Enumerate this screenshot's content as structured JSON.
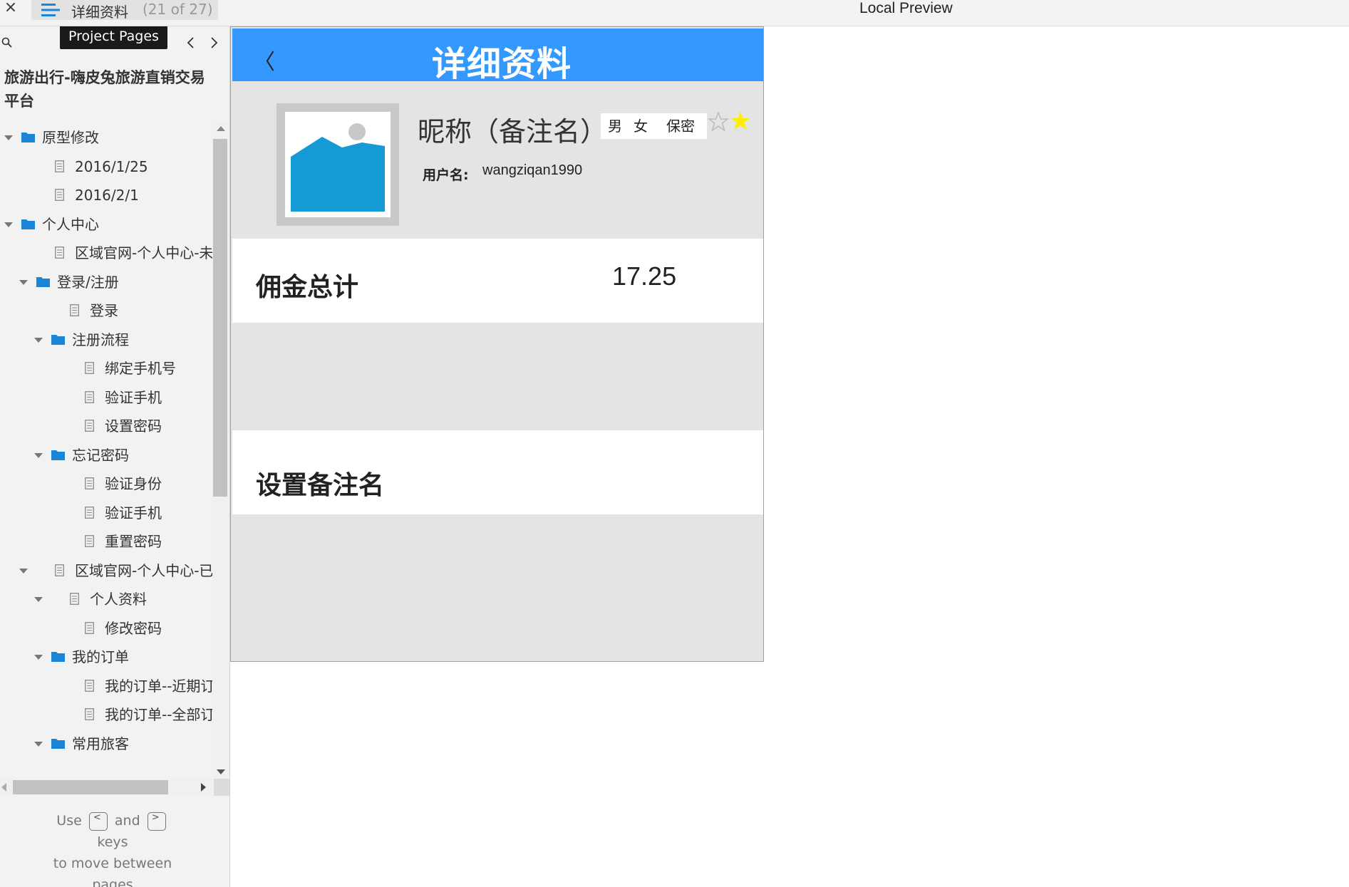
{
  "topbar": {
    "close_glyph": "×",
    "page_title": "详细资料",
    "page_count": "(21 of 27)",
    "preview_title": "Local Preview"
  },
  "sidebar": {
    "tooltip": "Project Pages",
    "project_title": "旅游出行-嗨皮兔旅游直销交易平台",
    "tree": [
      {
        "label": "原型修改",
        "type": "folder",
        "level": 0,
        "expanded": true
      },
      {
        "label": "2016/1/25",
        "type": "page",
        "level": 1
      },
      {
        "label": "2016/2/1",
        "type": "page",
        "level": 1
      },
      {
        "label": "个人中心",
        "type": "folder",
        "level": 0,
        "expanded": true
      },
      {
        "label": "区域官网-个人中心-未登",
        "type": "page",
        "level": 1
      },
      {
        "label": "登录/注册",
        "type": "folder",
        "level": 1,
        "expanded": true
      },
      {
        "label": "登录",
        "type": "page",
        "level": 2
      },
      {
        "label": "注册流程",
        "type": "folder",
        "level": 2,
        "expanded": true
      },
      {
        "label": "绑定手机号",
        "type": "page",
        "level": 3
      },
      {
        "label": "验证手机",
        "type": "page",
        "level": 3
      },
      {
        "label": "设置密码",
        "type": "page",
        "level": 3
      },
      {
        "label": "忘记密码",
        "type": "folder",
        "level": 2,
        "expanded": true
      },
      {
        "label": "验证身份",
        "type": "page",
        "level": 3
      },
      {
        "label": "验证手机",
        "type": "page",
        "level": 3
      },
      {
        "label": "重置密码",
        "type": "page",
        "level": 3
      },
      {
        "label": "区域官网-个人中心-已登",
        "type": "page",
        "level": 1,
        "expanded": true
      },
      {
        "label": "个人资料",
        "type": "page",
        "level": 2,
        "expanded": true
      },
      {
        "label": "修改密码",
        "type": "page",
        "level": 3
      },
      {
        "label": "我的订单",
        "type": "folder",
        "level": 2,
        "expanded": true
      },
      {
        "label": "我的订单--近期订",
        "type": "page",
        "level": 3
      },
      {
        "label": "我的订单--全部订",
        "type": "page",
        "level": 3
      },
      {
        "label": "常用旅客",
        "type": "folder",
        "level": 2,
        "expanded": true
      }
    ],
    "help": {
      "use": "Use",
      "and": "and",
      "keys": "keys",
      "line3": "to move between",
      "line4": "pages",
      "key_prev": "<",
      "key_next": ">"
    }
  },
  "preview": {
    "header_title": "详细资料",
    "back_glyph": "〈",
    "nickname": "昵称（备注名）",
    "gender_options": [
      "男",
      "女",
      "保密"
    ],
    "username_label": "用户名:",
    "username": "wangziqan1990",
    "commission_label": "佣金总计",
    "commission_value": "17.25",
    "remark_label": "设置备注名"
  },
  "colors": {
    "header_blue": "#3399ff",
    "folder_blue": "#1a85d6",
    "image_placeholder_blue": "#159ad6",
    "star_yellow": "#ffee00"
  }
}
